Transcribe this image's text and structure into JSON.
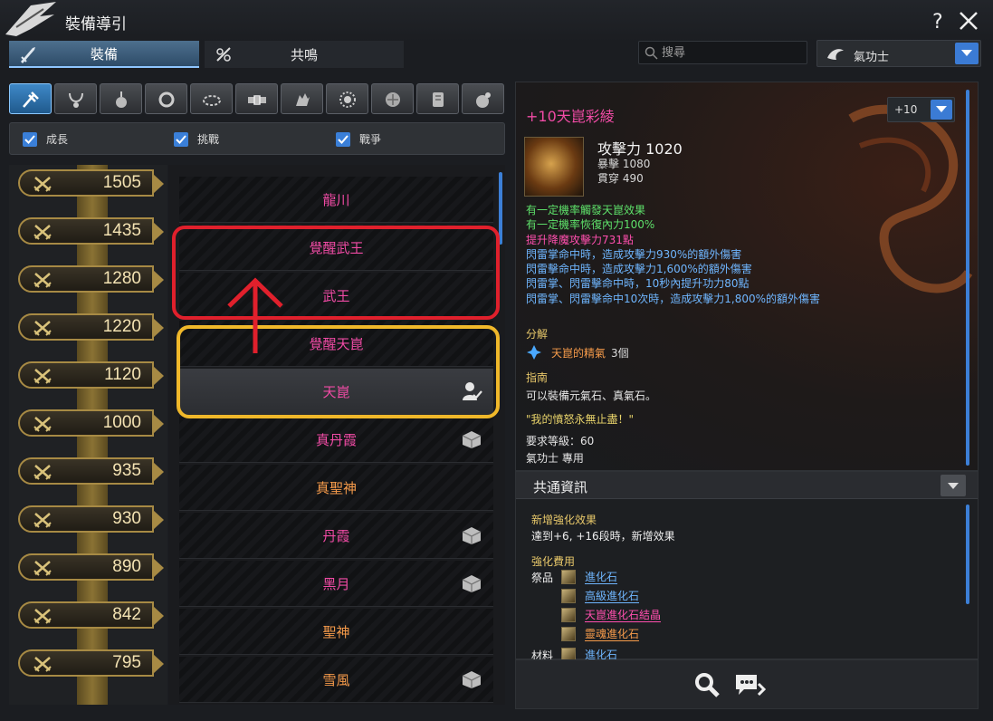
{
  "window": {
    "title": "裝備導引"
  },
  "tabs": [
    {
      "label": "裝備",
      "active": true
    },
    {
      "label": "共鳴",
      "active": false
    }
  ],
  "search": {
    "placeholder": "搜尋",
    "value": ""
  },
  "class_select": {
    "label": "氣功士",
    "icon": "class-emblem-icon"
  },
  "slots": [
    {
      "icon": "weapon-icon",
      "active": true
    },
    {
      "icon": "necklace-icon"
    },
    {
      "icon": "earring-icon"
    },
    {
      "icon": "ring-icon"
    },
    {
      "icon": "bracelet-icon"
    },
    {
      "icon": "belt-icon"
    },
    {
      "icon": "glove-icon"
    },
    {
      "icon": "soul-icon"
    },
    {
      "icon": "heart-icon"
    },
    {
      "icon": "talisman-icon"
    },
    {
      "icon": "pet-icon"
    }
  ],
  "filters": [
    {
      "label": "成長",
      "checked": true
    },
    {
      "label": "挑戰",
      "checked": true
    },
    {
      "label": "戰爭",
      "checked": true
    }
  ],
  "levels": [
    "1505",
    "1435",
    "1280",
    "1220",
    "1120",
    "1000",
    "935",
    "930",
    "890",
    "842",
    "795"
  ],
  "weapons": [
    {
      "name": "龍川",
      "color": "pink",
      "icon": ""
    },
    {
      "name": "覺醒武王",
      "color": "pink",
      "icon": ""
    },
    {
      "name": "武王",
      "color": "pink",
      "icon": ""
    },
    {
      "name": "覺醒天崑",
      "color": "pink",
      "icon": ""
    },
    {
      "name": "天崑",
      "color": "pink",
      "icon": "user-check-icon",
      "selected": true
    },
    {
      "name": "真丹霞",
      "color": "pink",
      "icon": "box-icon"
    },
    {
      "name": "真聖神",
      "color": "orange",
      "icon": ""
    },
    {
      "name": "丹霞",
      "color": "pink",
      "icon": "box-icon"
    },
    {
      "name": "黑月",
      "color": "pink",
      "icon": "box-icon"
    },
    {
      "name": "聖神",
      "color": "orange",
      "icon": ""
    },
    {
      "name": "雪風",
      "color": "orange",
      "icon": "box-icon"
    }
  ],
  "detail": {
    "title": "+10天崑彩綾",
    "enhance_level": "+10",
    "attack_main": "攻擊力 1020",
    "stats": [
      "暴擊 1080",
      "貫穿 490"
    ],
    "effects": [
      {
        "text": "有一定機率觸發天崑效果",
        "color": "green"
      },
      {
        "text": "有一定機率恢復內力100%",
        "color": "green"
      },
      {
        "text": "提升降魔攻擊力731點",
        "color": "pink"
      },
      {
        "text": "閃雷掌命中時，造成攻擊力930%的額外傷害",
        "color": "blue"
      },
      {
        "text": "閃雷擊命中時，造成攻擊力1,600%的額外傷害",
        "color": "blue"
      },
      {
        "text": "閃雷掌、閃雷擊命中時，10秒內提升功力80點",
        "color": "blue"
      },
      {
        "text": "閃雷掌、閃雷擊命中10次時，造成攻擊力1,800%的額外傷害",
        "color": "blue"
      }
    ],
    "dismantle_label": "分解",
    "dismantle_item": "天崑的精氣",
    "dismantle_count": "3個",
    "guide_label": "指南",
    "guide_text": "可以裝備元氣石、真氣石。",
    "quote": "\"我的憤怒永無止盡！\"",
    "req_level": "要求等級：60",
    "class_only": "氣功士 專用"
  },
  "shared": {
    "title": "共通資訊",
    "new_effect_label": "新增強化效果",
    "new_effect_text": "達到+6, +16段時，新增效果",
    "cost_label": "強化費用",
    "offering_label": "祭品",
    "material_label": "材料",
    "offerings": [
      {
        "name": "進化石",
        "color": "blue"
      },
      {
        "name": "高級進化石",
        "color": "blue"
      },
      {
        "name": "天崑進化石結晶",
        "color": "pink"
      },
      {
        "name": "靈魂進化石",
        "color": "orange"
      }
    ],
    "materials": [
      {
        "name": "進化石",
        "color": "blue"
      }
    ]
  },
  "colors": {
    "accent": "#3b7bd4",
    "pink": "#f04ba5",
    "orange": "#f59a4a",
    "highlight_red": "#e0202c",
    "highlight_yellow": "#f0b82a"
  }
}
